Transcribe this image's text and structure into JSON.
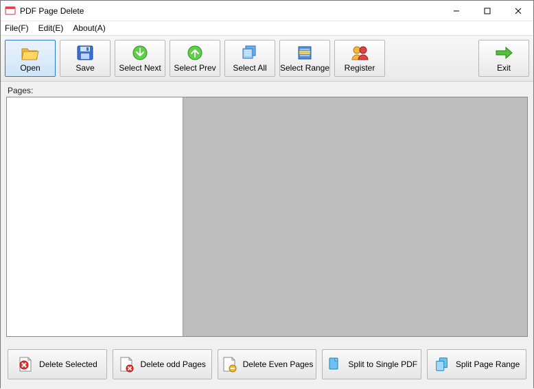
{
  "window": {
    "title": "PDF Page Delete"
  },
  "menu": {
    "file": "File(F)",
    "edit": "Edit(E)",
    "about": "About(A)"
  },
  "toolbar": {
    "open": "Open",
    "save": "Save",
    "select_next": "Select Next",
    "select_prev": "Select Prev",
    "select_all": "Select All",
    "select_range": "Select Range",
    "register": "Register",
    "exit": "Exit"
  },
  "labels": {
    "pages": "Pages:"
  },
  "bottom": {
    "delete_selected": "Delete Selected",
    "delete_odd": "Delete odd Pages",
    "delete_even": "Delete Even Pages",
    "split_single": "Split to Single PDF",
    "split_range": "Split Page Range"
  }
}
